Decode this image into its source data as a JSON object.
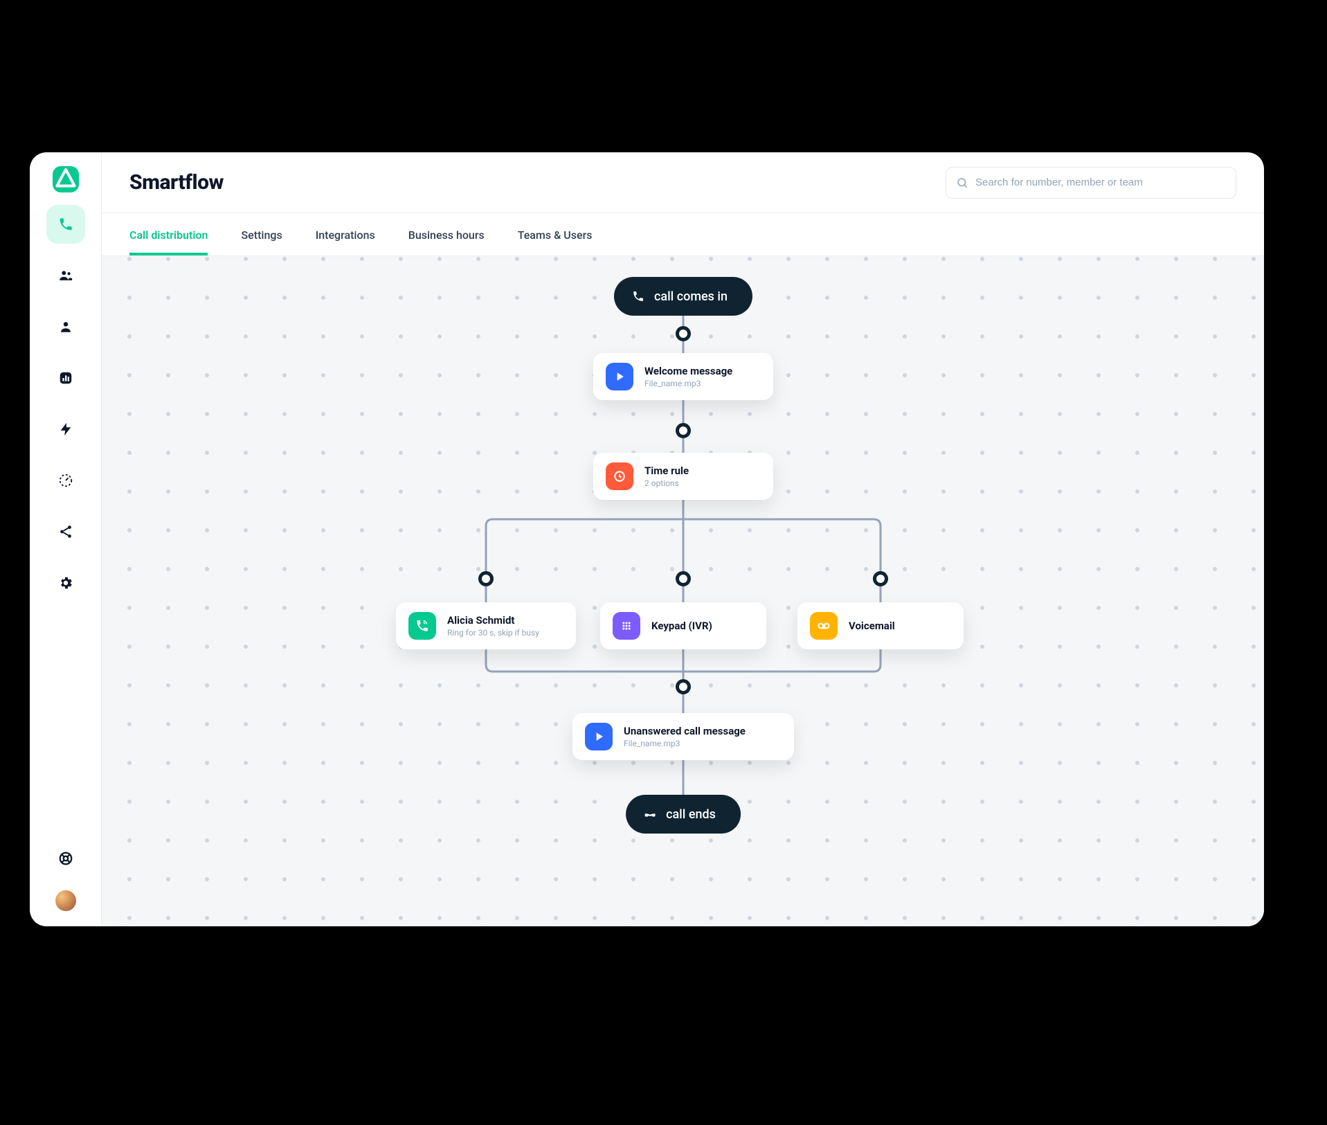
{
  "header": {
    "title": "Smartflow",
    "search_placeholder": "Search for number, member or team"
  },
  "tabs": {
    "call_distribution": "Call distribution",
    "settings": "Settings",
    "integrations": "Integrations",
    "business_hours": "Business hours",
    "teams_users": "Teams & Users"
  },
  "flow": {
    "start_label": "call comes in",
    "end_label": "call ends",
    "nodes": {
      "welcome": {
        "title": "Welcome message",
        "subtitle": "File_name.mp3"
      },
      "time_rule": {
        "title": "Time rule",
        "subtitle": "2 options"
      },
      "alicia": {
        "title": "Alicia Schmidt",
        "subtitle": "Ring for 30 s, skip if busy"
      },
      "keypad": {
        "title": "Keypad (IVR)"
      },
      "voicemail": {
        "title": "Voicemail"
      },
      "unanswered": {
        "title": "Unanswered call message",
        "subtitle": "File_name.mp3"
      }
    }
  },
  "sidebar": {
    "items": {
      "phone": "phone",
      "people": "people",
      "person": "person",
      "stats": "stats",
      "activity": "activity",
      "performance": "performance",
      "share": "share",
      "settings": "settings",
      "help": "help"
    }
  }
}
